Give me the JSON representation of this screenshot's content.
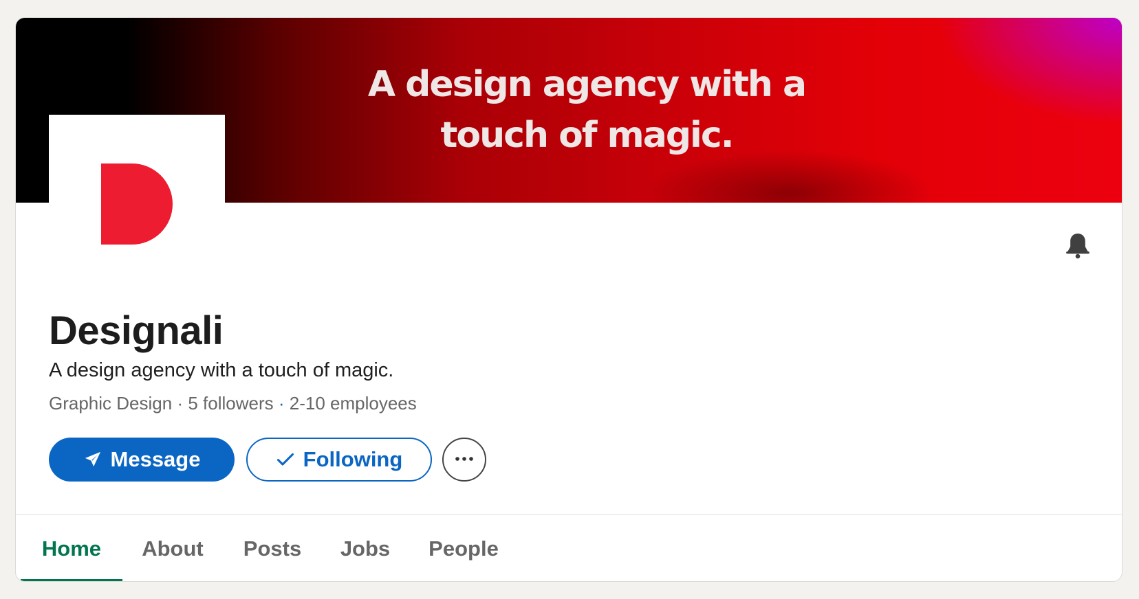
{
  "banner": {
    "text_line1": "A design agency with a",
    "text_line2": "touch of magic."
  },
  "company": {
    "logo_icon": "designali-d-logo",
    "name": "Designali",
    "tagline": "A design agency with a touch of magic.",
    "industry": "Graphic Design",
    "followers": "5 followers",
    "employees": "2-10 employees",
    "separator": "·"
  },
  "actions": {
    "message_label": "Message",
    "message_icon": "send-icon",
    "following_label": "Following",
    "following_icon": "checkmark-icon",
    "more_icon": "ellipsis-icon",
    "bell_icon": "bell-icon"
  },
  "tabs": [
    {
      "label": "Home",
      "active": true
    },
    {
      "label": "About",
      "active": false
    },
    {
      "label": "Posts",
      "active": false
    },
    {
      "label": "Jobs",
      "active": false
    },
    {
      "label": "People",
      "active": false
    }
  ],
  "colors": {
    "primary_blue": "#0a66c2",
    "active_tab_green": "#01754f",
    "logo_red": "#ed1c31",
    "page_bg": "#f4f2ee"
  }
}
